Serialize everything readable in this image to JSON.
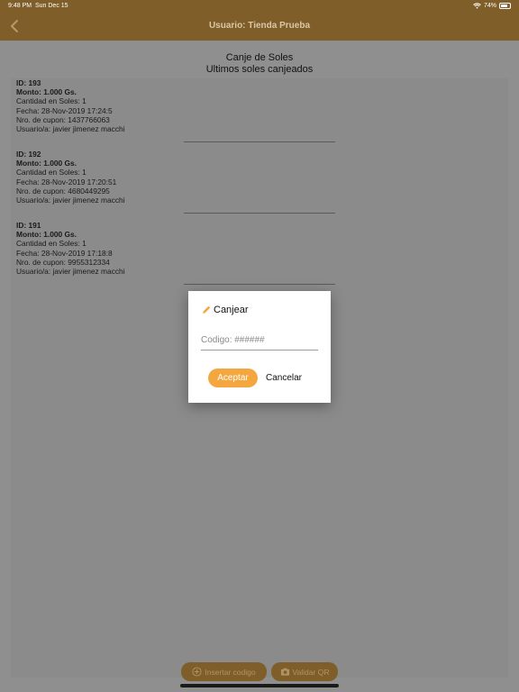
{
  "status_bar": {
    "time": "9:48 PM",
    "date": "Sun Dec 15",
    "battery": "74%",
    "battery_level": 0.74
  },
  "navbar": {
    "title": "Usuario: Tienda Prueba",
    "back_icon": "chevron-left-icon"
  },
  "header": {
    "title": "Canje de Soles",
    "subtitle": "Ultimos soles canjeados"
  },
  "entries": [
    {
      "id": "ID: 193",
      "monto": "Monto: 1.000 Gs.",
      "cantidad": "Cantidad en Soles: 1",
      "fecha": "Fecha: 28-Nov-2019 17:24:5",
      "cupon": "Nro. de cupon: 1437766063",
      "usuario": "Usuario/a: javier jimenez macchi"
    },
    {
      "id": "ID: 192",
      "monto": "Monto: 1.000 Gs.",
      "cantidad": "Cantidad en Soles: 1",
      "fecha": "Fecha: 28-Nov-2019 17:20:51",
      "cupon": "Nro. de cupon: 4680449295",
      "usuario": "Usuario/a: javier jimenez macchi"
    },
    {
      "id": "ID: 191",
      "monto": "Monto: 1.000 Gs.",
      "cantidad": "Cantidad en Soles: 1",
      "fecha": "Fecha: 28-Nov-2019 17:18:8",
      "cupon": "Nro. de cupon: 9955312334",
      "usuario": "Usuario/a: javier jimenez macchi"
    }
  ],
  "bottom_buttons": {
    "insert_label": "Insertar codigo",
    "scan_label": "Validar QR"
  },
  "dialog": {
    "title": "Canjear",
    "input_placeholder": "Codigo: ######",
    "accept_label": "Aceptar",
    "cancel_label": "Cancelar",
    "accent_color": "#f4a73f"
  }
}
